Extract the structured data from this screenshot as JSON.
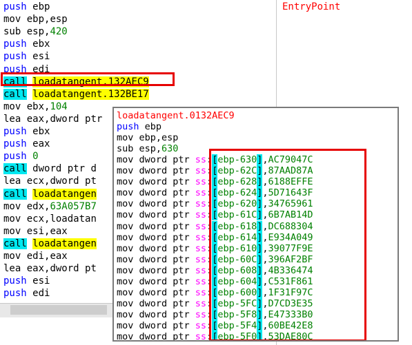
{
  "entry_label": "EntryPoint",
  "main_lines": [
    {
      "op": "push",
      "kind": "plain",
      "args": "ebp"
    },
    {
      "op": "mov",
      "kind": "plain",
      "args": "ebp,esp"
    },
    {
      "op": "sub",
      "kind": "plain",
      "args": "esp,420"
    },
    {
      "op": "push",
      "kind": "plain",
      "args": "ebx"
    },
    {
      "op": "push",
      "kind": "plain",
      "args": "esi"
    },
    {
      "op": "push",
      "kind": "plain",
      "args": "edi"
    },
    {
      "op": "call",
      "kind": "call",
      "args": "loadatangent.132AEC9"
    },
    {
      "op": "call",
      "kind": "call",
      "args": "loadatangent.132BE17"
    },
    {
      "op": "mov",
      "kind": "plain",
      "args": "ebx,104"
    },
    {
      "op": "lea",
      "kind": "plain",
      "args": "eax,dword ptr"
    },
    {
      "op": "push",
      "kind": "plain",
      "args": "ebx"
    },
    {
      "op": "push",
      "kind": "plain",
      "args": "eax"
    },
    {
      "op": "push",
      "kind": "plain",
      "args": "0"
    },
    {
      "op": "call",
      "kind": "callptr",
      "args": "dword ptr d"
    },
    {
      "op": "lea",
      "kind": "plain",
      "args": "ecx,dword pt"
    },
    {
      "op": "call",
      "kind": "call",
      "args": "loadatangen"
    },
    {
      "op": "mov",
      "kind": "plain",
      "args": "edx,63A057B7"
    },
    {
      "op": "mov",
      "kind": "plain",
      "args": "ecx,loadatan"
    },
    {
      "op": "mov",
      "kind": "plain",
      "args": "esi,eax"
    },
    {
      "op": "call",
      "kind": "call",
      "args": "loadatangen"
    },
    {
      "op": "mov",
      "kind": "plain",
      "args": "edi,eax"
    },
    {
      "op": "lea",
      "kind": "plain",
      "args": "eax,dword pt"
    },
    {
      "op": "push",
      "kind": "plain",
      "args": "esi"
    },
    {
      "op": "push",
      "kind": "plain",
      "args": "edi"
    }
  ],
  "popup": {
    "title": "loadatangent.0132AEC9",
    "header_lines": [
      {
        "op": "push",
        "args": "ebp"
      },
      {
        "op": "mov",
        "args": "ebp,esp"
      },
      {
        "op": "sub",
        "args": "esp,630"
      }
    ],
    "mov_prefix": "mov dword ptr ",
    "seg": "ss",
    "lbr": "[",
    "rbr": "]",
    "stores": [
      {
        "off": "ebp-630",
        "val": "AC79047C"
      },
      {
        "off": "ebp-62C",
        "val": "87AAD87A"
      },
      {
        "off": "ebp-628",
        "val": "6188EFFE"
      },
      {
        "off": "ebp-624",
        "val": "5D71643F"
      },
      {
        "off": "ebp-620",
        "val": "34765961"
      },
      {
        "off": "ebp-61C",
        "val": "6B7AB14D"
      },
      {
        "off": "ebp-618",
        "val": "DC688304"
      },
      {
        "off": "ebp-614",
        "val": "E934A049"
      },
      {
        "off": "ebp-610",
        "val": "39077F9E"
      },
      {
        "off": "ebp-60C",
        "val": "396AF2BF"
      },
      {
        "off": "ebp-608",
        "val": "4B336474"
      },
      {
        "off": "ebp-604",
        "val": "C531F861"
      },
      {
        "off": "ebp-600",
        "val": "1F31F97C"
      },
      {
        "off": "ebp-5FC",
        "val": "D7CD3E35"
      },
      {
        "off": "ebp-5F8",
        "val": "E47333B0"
      },
      {
        "off": "ebp-5F4",
        "val": "60BE42E8"
      },
      {
        "off": "ebp-5F0",
        "val": "53DAE80C"
      }
    ]
  }
}
